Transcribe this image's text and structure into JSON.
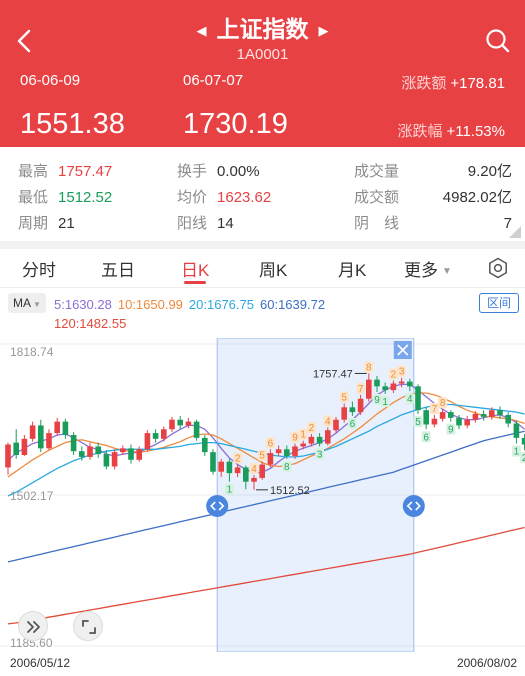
{
  "header": {
    "title": "上证指数",
    "code": "1A0001",
    "date_start": "06-06-09",
    "date_end": "06-07-07",
    "price_start": "1551.38",
    "price_end": "1730.19",
    "change_amount_label": "涨跌额",
    "change_amount_value": "+178.81",
    "change_pct_label": "涨跌幅",
    "change_pct_value": "+11.53%",
    "bg_color": "#e84144"
  },
  "stats": {
    "high_label": "最高",
    "high_value": "1757.47",
    "turnover_label": "换手",
    "turnover_value": "0.00%",
    "volume_label": "成交量",
    "volume_value": "9.20亿",
    "low_label": "最低",
    "low_value": "1512.52",
    "avg_label": "均价",
    "avg_value": "1623.62",
    "amount_label": "成交额",
    "amount_value": "4982.02亿",
    "period_label": "周期",
    "period_value": "21",
    "up_label": "阳线",
    "up_value": "14",
    "down_label": "阴　线",
    "down_value": "7"
  },
  "tabs": [
    {
      "label": "分时"
    },
    {
      "label": "五日"
    },
    {
      "label": "日K",
      "active": true
    },
    {
      "label": "周K"
    },
    {
      "label": "月K"
    },
    {
      "label": "更多"
    }
  ],
  "ma_legend": {
    "button_label": "MA",
    "ma5": "5:1630.28",
    "ma10": "10:1650.99",
    "ma20": "20:1676.75",
    "ma60": "60:1639.72",
    "ma120": "120:1482.55",
    "range_button": "区间",
    "colors": {
      "ma5": "#8c6fd8",
      "ma10": "#f08a3c",
      "ma20": "#2aa8df",
      "ma60": "#3d6fc7",
      "ma120": "#e14b3b"
    }
  },
  "chart_data": {
    "type": "candlestick",
    "y_axis_labels": [
      "1818.74",
      "1502.17",
      "1185.60"
    ],
    "ylim": [
      1185.6,
      1818.74
    ],
    "x_start_label": "2006/05/12",
    "x_end_label": "2006/08/02",
    "high_marker": "1757.47",
    "low_marker": "1512.52",
    "up_color": "#e84144",
    "down_color": "#1a9d5a",
    "candles": [
      [
        1560,
        1608,
        1545,
        1612
      ],
      [
        1612,
        1586,
        1578,
        1640
      ],
      [
        1586,
        1620,
        1584,
        1628
      ],
      [
        1620,
        1648,
        1614,
        1656
      ],
      [
        1648,
        1600,
        1592,
        1660
      ],
      [
        1600,
        1632,
        1596,
        1640
      ],
      [
        1632,
        1656,
        1626,
        1664
      ],
      [
        1656,
        1628,
        1620,
        1662
      ],
      [
        1628,
        1594,
        1586,
        1634
      ],
      [
        1594,
        1582,
        1574,
        1604
      ],
      [
        1582,
        1604,
        1576,
        1612
      ],
      [
        1604,
        1588,
        1580,
        1612
      ],
      [
        1588,
        1562,
        1556,
        1596
      ],
      [
        1562,
        1592,
        1556,
        1598
      ],
      [
        1592,
        1600,
        1586,
        1606
      ],
      [
        1600,
        1576,
        1568,
        1608
      ],
      [
        1576,
        1598,
        1572,
        1604
      ],
      [
        1598,
        1632,
        1594,
        1638
      ],
      [
        1632,
        1620,
        1612,
        1640
      ],
      [
        1620,
        1640,
        1614,
        1646
      ],
      [
        1640,
        1660,
        1634,
        1666
      ],
      [
        1660,
        1648,
        1640,
        1668
      ],
      [
        1648,
        1656,
        1642,
        1664
      ],
      [
        1656,
        1622,
        1616,
        1660
      ],
      [
        1622,
        1592,
        1584,
        1628
      ],
      [
        1592,
        1551,
        1545,
        1598
      ],
      [
        1551,
        1572,
        1540,
        1578
      ],
      [
        1572,
        1548,
        1530,
        1578
      ],
      [
        1548,
        1560,
        1540,
        1566
      ],
      [
        1560,
        1530,
        1514,
        1564
      ],
      [
        1530,
        1538,
        1513,
        1544
      ],
      [
        1538,
        1566,
        1534,
        1572
      ],
      [
        1566,
        1590,
        1560,
        1598
      ],
      [
        1590,
        1598,
        1584,
        1606
      ],
      [
        1598,
        1584,
        1578,
        1606
      ],
      [
        1584,
        1604,
        1578,
        1610
      ],
      [
        1604,
        1610,
        1598,
        1616
      ],
      [
        1610,
        1624,
        1604,
        1630
      ],
      [
        1624,
        1610,
        1604,
        1632
      ],
      [
        1610,
        1638,
        1606,
        1644
      ],
      [
        1638,
        1660,
        1632,
        1666
      ],
      [
        1660,
        1686,
        1654,
        1694
      ],
      [
        1686,
        1676,
        1668,
        1698
      ],
      [
        1676,
        1704,
        1670,
        1712
      ],
      [
        1704,
        1744,
        1698,
        1757
      ],
      [
        1744,
        1730,
        1718,
        1752
      ],
      [
        1730,
        1722,
        1714,
        1738
      ],
      [
        1722,
        1736,
        1716,
        1742
      ],
      [
        1736,
        1740,
        1728,
        1748
      ],
      [
        1740,
        1730,
        1720,
        1746
      ],
      [
        1730,
        1680,
        1672,
        1734
      ],
      [
        1680,
        1650,
        1640,
        1686
      ],
      [
        1650,
        1662,
        1644,
        1670
      ],
      [
        1662,
        1676,
        1656,
        1682
      ],
      [
        1676,
        1664,
        1656,
        1680
      ],
      [
        1664,
        1648,
        1640,
        1670
      ],
      [
        1648,
        1660,
        1642,
        1668
      ],
      [
        1660,
        1672,
        1654,
        1678
      ],
      [
        1672,
        1666,
        1658,
        1680
      ],
      [
        1666,
        1680,
        1660,
        1686
      ],
      [
        1680,
        1670,
        1662,
        1688
      ],
      [
        1670,
        1652,
        1644,
        1676
      ],
      [
        1652,
        1622,
        1610,
        1658
      ],
      [
        1622,
        1608,
        1596,
        1630
      ]
    ],
    "series": [
      {
        "name": "5",
        "values": [
          1575,
          1590,
          1600,
          1610,
          1615,
          1620,
          1628,
          1630,
          1622,
          1612,
          1602,
          1598,
          1588,
          1584,
          1588,
          1590,
          1592,
          1600,
          1608,
          1618,
          1630,
          1640,
          1648,
          1648,
          1640,
          1622,
          1600,
          1580,
          1566,
          1556,
          1548,
          1550,
          1558,
          1572,
          1584,
          1594,
          1600,
          1606,
          1612,
          1620,
          1632,
          1646,
          1660,
          1676,
          1694,
          1712,
          1722,
          1730,
          1734,
          1734,
          1722,
          1708,
          1694,
          1682,
          1672,
          1664,
          1660,
          1660,
          1664,
          1668,
          1670,
          1664,
          1654,
          1640
        ]
      },
      {
        "name": "10",
        "values": [
          1540,
          1552,
          1564,
          1576,
          1586,
          1596,
          1604,
          1612,
          1616,
          1618,
          1614,
          1610,
          1606,
          1600,
          1596,
          1594,
          1592,
          1594,
          1598,
          1602,
          1608,
          1614,
          1622,
          1628,
          1630,
          1628,
          1620,
          1610,
          1600,
          1590,
          1580,
          1570,
          1564,
          1562,
          1564,
          1568,
          1576,
          1584,
          1592,
          1600,
          1610,
          1620,
          1632,
          1644,
          1658,
          1672,
          1684,
          1696,
          1706,
          1714,
          1716,
          1716,
          1712,
          1706,
          1698,
          1688,
          1680,
          1674,
          1668,
          1666,
          1664,
          1662,
          1658,
          1652
        ]
      },
      {
        "name": "20",
        "values": [
          1500,
          1508,
          1518,
          1528,
          1538,
          1548,
          1558,
          1566,
          1574,
          1580,
          1586,
          1590,
          1594,
          1596,
          1598,
          1598,
          1598,
          1598,
          1598,
          1600,
          1602,
          1604,
          1608,
          1610,
          1612,
          1612,
          1610,
          1606,
          1602,
          1598,
          1594,
          1590,
          1586,
          1584,
          1582,
          1582,
          1584,
          1588,
          1592,
          1598,
          1604,
          1612,
          1620,
          1628,
          1636,
          1646,
          1654,
          1662,
          1670,
          1676,
          1682,
          1686,
          1690,
          1692,
          1692,
          1690,
          1688,
          1686,
          1684,
          1682,
          1680,
          1678,
          1676,
          1672
        ]
      },
      {
        "name": "60",
        "values": [
          1362,
          1366,
          1370,
          1374,
          1378,
          1382,
          1386,
          1390,
          1394,
          1398,
          1402,
          1406,
          1410,
          1414,
          1418,
          1422,
          1426,
          1430,
          1434,
          1438,
          1442,
          1446,
          1450,
          1454,
          1458,
          1462,
          1466,
          1470,
          1474,
          1478,
          1482,
          1486,
          1490,
          1494,
          1498,
          1502,
          1506,
          1510,
          1514,
          1518,
          1522,
          1526,
          1530,
          1534,
          1538,
          1542,
          1546,
          1550,
          1556,
          1562,
          1568,
          1574,
          1580,
          1586,
          1592,
          1598,
          1604,
          1610,
          1616,
          1620,
          1624,
          1628,
          1632,
          1636
        ]
      },
      {
        "name": "120",
        "values": [
          1232,
          1234,
          1237,
          1240,
          1243,
          1246,
          1249,
          1252,
          1255,
          1258,
          1261,
          1264,
          1267,
          1270,
          1273,
          1276,
          1279,
          1282,
          1285,
          1288,
          1291,
          1294,
          1297,
          1300,
          1303,
          1306,
          1309,
          1312,
          1315,
          1318,
          1321,
          1324,
          1327,
          1330,
          1333,
          1336,
          1339,
          1342,
          1345,
          1348,
          1351,
          1354,
          1357,
          1360,
          1363,
          1366,
          1369,
          1372,
          1375,
          1378,
          1382,
          1386,
          1390,
          1394,
          1398,
          1402,
          1406,
          1410,
          1414,
          1418,
          1422,
          1426,
          1430,
          1434
        ]
      }
    ],
    "selection": {
      "start_index": 26,
      "end_index": 49
    },
    "markers": [
      {
        "i": 27,
        "label": "1"
      },
      {
        "i": 28,
        "label": "2"
      },
      {
        "i": 30,
        "label": "4"
      },
      {
        "i": 31,
        "label": "5"
      },
      {
        "i": 32,
        "label": "6"
      },
      {
        "i": 34,
        "label": "8"
      },
      {
        "i": 35,
        "label": "9"
      },
      {
        "i": 36,
        "label": "1"
      },
      {
        "i": 37,
        "label": "2"
      },
      {
        "i": 38,
        "label": "3"
      },
      {
        "i": 39,
        "label": "4"
      },
      {
        "i": 41,
        "label": "5"
      },
      {
        "i": 42,
        "label": "6"
      },
      {
        "i": 43,
        "label": "7"
      },
      {
        "i": 44,
        "label": "8"
      },
      {
        "i": 45,
        "label": "9"
      },
      {
        "i": 46,
        "label": "1"
      },
      {
        "i": 47,
        "label": "2"
      },
      {
        "i": 48,
        "label": "3"
      },
      {
        "i": 49,
        "label": "4"
      },
      {
        "i": 50,
        "label": "5"
      },
      {
        "i": 51,
        "label": "6"
      },
      {
        "i": 52,
        "label": "7"
      },
      {
        "i": 53,
        "label": "8"
      },
      {
        "i": 54,
        "label": "9"
      },
      {
        "i": 62,
        "label": "1"
      },
      {
        "i": 63,
        "label": "2"
      },
      {
        "i": 64,
        "label": "3"
      }
    ]
  }
}
